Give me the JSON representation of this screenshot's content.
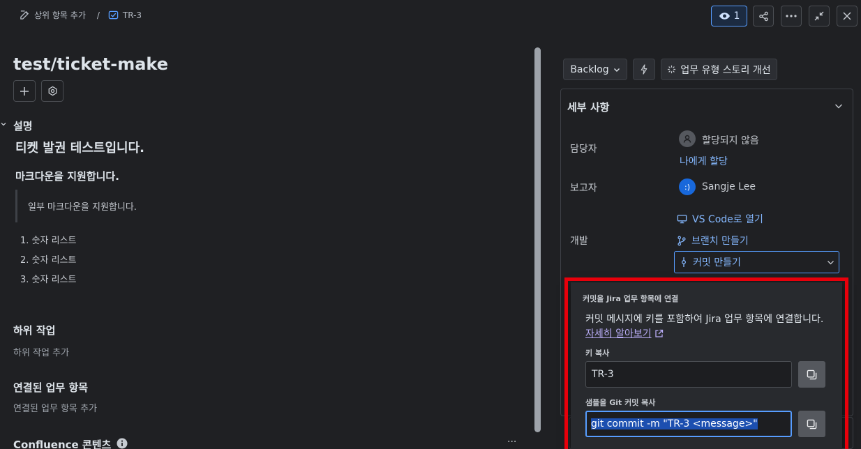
{
  "breadcrumb": {
    "parent_label": "상위 항목 추가",
    "separator": "/",
    "ticket_key": "TR-3"
  },
  "topbar": {
    "watch_count": "1"
  },
  "issue": {
    "title": "test/ticket-make"
  },
  "description": {
    "label": "설명",
    "heading1": "티켓 발권 테스트입니다.",
    "heading2": "마크다운을 지원합니다.",
    "quote": "일부 마크다운을 지원합니다.",
    "list": [
      "1. 숫자 리스트",
      "2. 숫자 리스트",
      "3. 숫자 리스트"
    ]
  },
  "subtasks": {
    "label": "하위 작업",
    "add": "하위 작업 추가"
  },
  "linked": {
    "label": "연결된 업무 항목",
    "add": "연결된 업무 항목 추가"
  },
  "confluence": {
    "label": "Confluence 콘텐츠",
    "more": "···"
  },
  "status": {
    "backlog": "Backlog",
    "improve": "업무 유형 스토리 개선"
  },
  "details": {
    "title": "세부 사항",
    "assignee_label": "담당자",
    "assignee_value": "할당되지 않음",
    "assign_me": "나에게 할당",
    "reporter_label": "보고자",
    "reporter_value": "Sangje Lee",
    "reporter_avatar": ":)",
    "dev_label": "개발",
    "open_vscode": "VS Code로 열기",
    "create_branch": "브랜치 만들기",
    "create_commit": "커밋 만들기"
  },
  "popup": {
    "title": "커밋을 Jira 업무 항목에 연결",
    "desc": "커밋 메시지에 키를 포함하여 Jira 업무 항목에 연결합니다.",
    "learn_more": "자세히 알아보기",
    "key_label": "키 복사",
    "key_value": "TR-3",
    "sample_label": "샘플을 Git 커밋 복사",
    "sample_value": "git commit -m \"TR-3 <message>\""
  },
  "colors": {
    "accent": "#579dff",
    "highlight": "#e8000b",
    "reporter_avatar": "#1868db"
  }
}
